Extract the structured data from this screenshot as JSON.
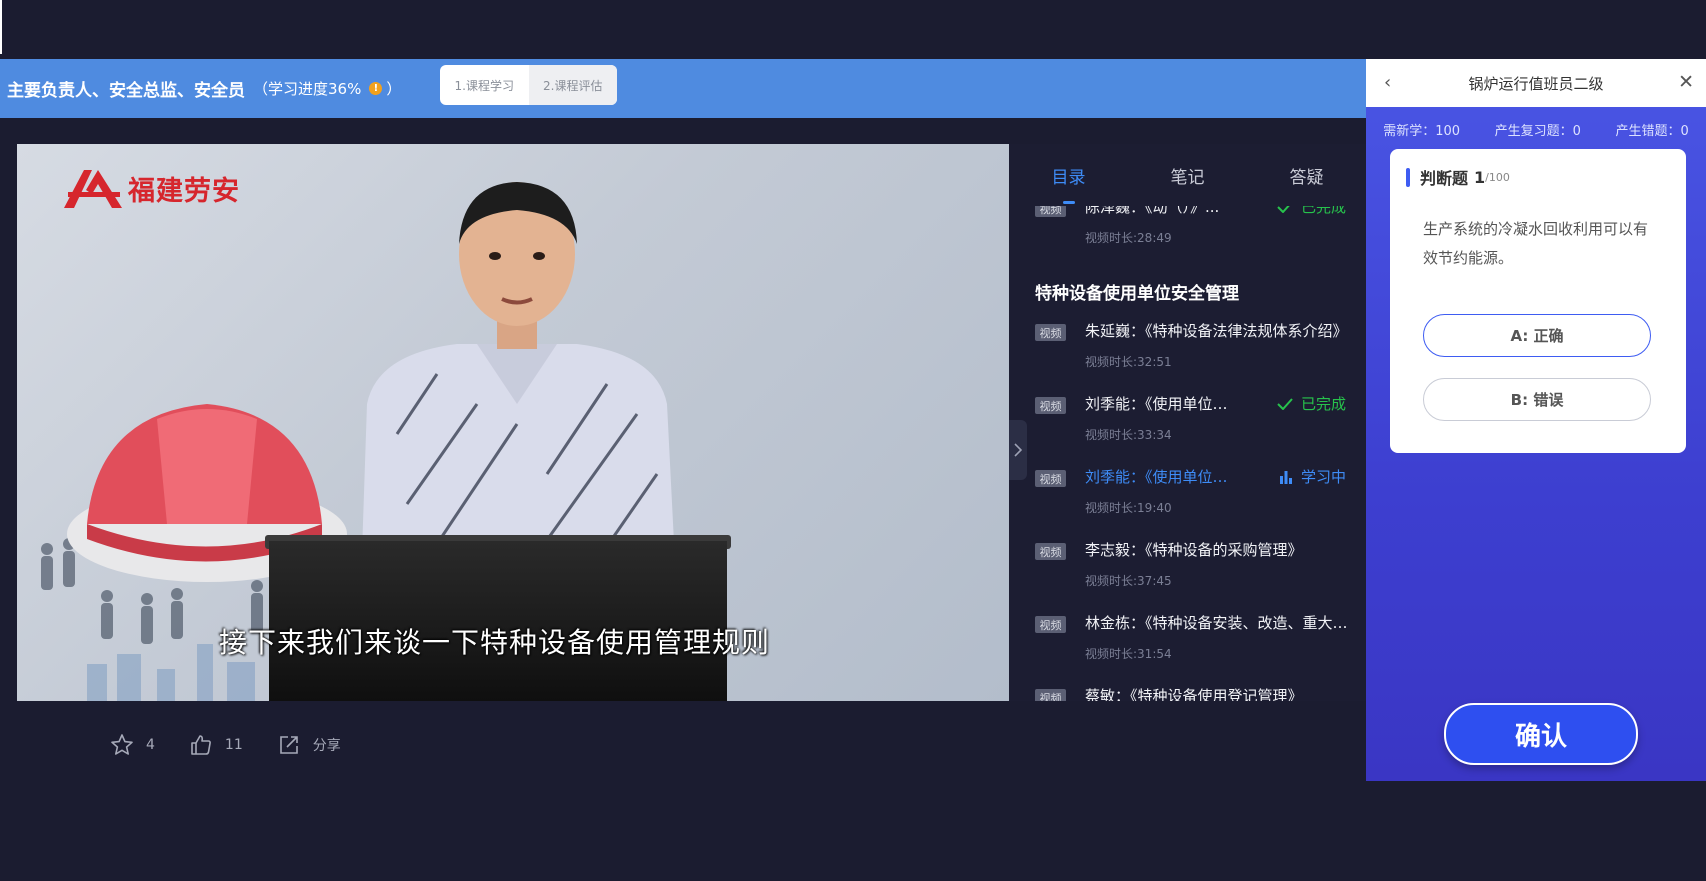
{
  "header": {
    "course_title": "主要负责人、安全总监、安全员",
    "progress_label": "（学习进度36%",
    "progress_close": "）",
    "steps": [
      "1.课程学习",
      "2.课程评估"
    ]
  },
  "video": {
    "logo_text": "福建劳安",
    "subtitle": "接下来我们来谈一下特种设备使用管理规则"
  },
  "actions": {
    "favorite_count": "4",
    "like_count": "11",
    "share_label": "分享"
  },
  "panel": {
    "tabs": [
      "目录",
      "笔记",
      "答疑"
    ],
    "top_item": {
      "badge": "视频",
      "name": "陈泽巍：《动（）》...",
      "duration": "视频时长:28:49",
      "status": "已完成"
    },
    "section_title": "特种设备使用单位安全管理",
    "items": [
      {
        "badge": "视频",
        "name": "朱延巍：《特种设备法律法规体系介绍》",
        "duration": "视频时长:32:51",
        "status": ""
      },
      {
        "badge": "视频",
        "name": "刘季能：《使用单位安全管理》",
        "duration": "视频时长:33:34",
        "status": "已完成"
      },
      {
        "badge": "视频",
        "name": "刘季能：《使用单位安全管理》",
        "duration": "视频时长:19:40",
        "status": "学习中"
      },
      {
        "badge": "视频",
        "name": "李志毅：《特种设备的采购管理》",
        "duration": "视频时长:37:45",
        "status": ""
      },
      {
        "badge": "视频",
        "name": "林金栋：《特种设备安装、改造、重大修理》",
        "duration": "视频时长:31:54",
        "status": ""
      },
      {
        "badge": "视频",
        "name": "蔡敏：《特种设备使用登记管理》",
        "duration": "",
        "status": ""
      }
    ]
  },
  "quiz": {
    "title": "锅炉运行值班员二级",
    "stats": [
      "需新学：100",
      "产生复习题：0",
      "产生错题：0"
    ],
    "question_type": "判断题",
    "question_number": "1",
    "question_total": "/100",
    "question_text": "生产系统的冷凝水回收利用可以有效节约能源。",
    "options": [
      "A: 正确",
      "B: 错误"
    ],
    "confirm_label": "确认"
  },
  "colors": {
    "header_blue": "#4f8be0",
    "accent_blue": "#3e8cf7",
    "done_green": "#27c24c",
    "quiz_blue": "#4a56e5"
  }
}
